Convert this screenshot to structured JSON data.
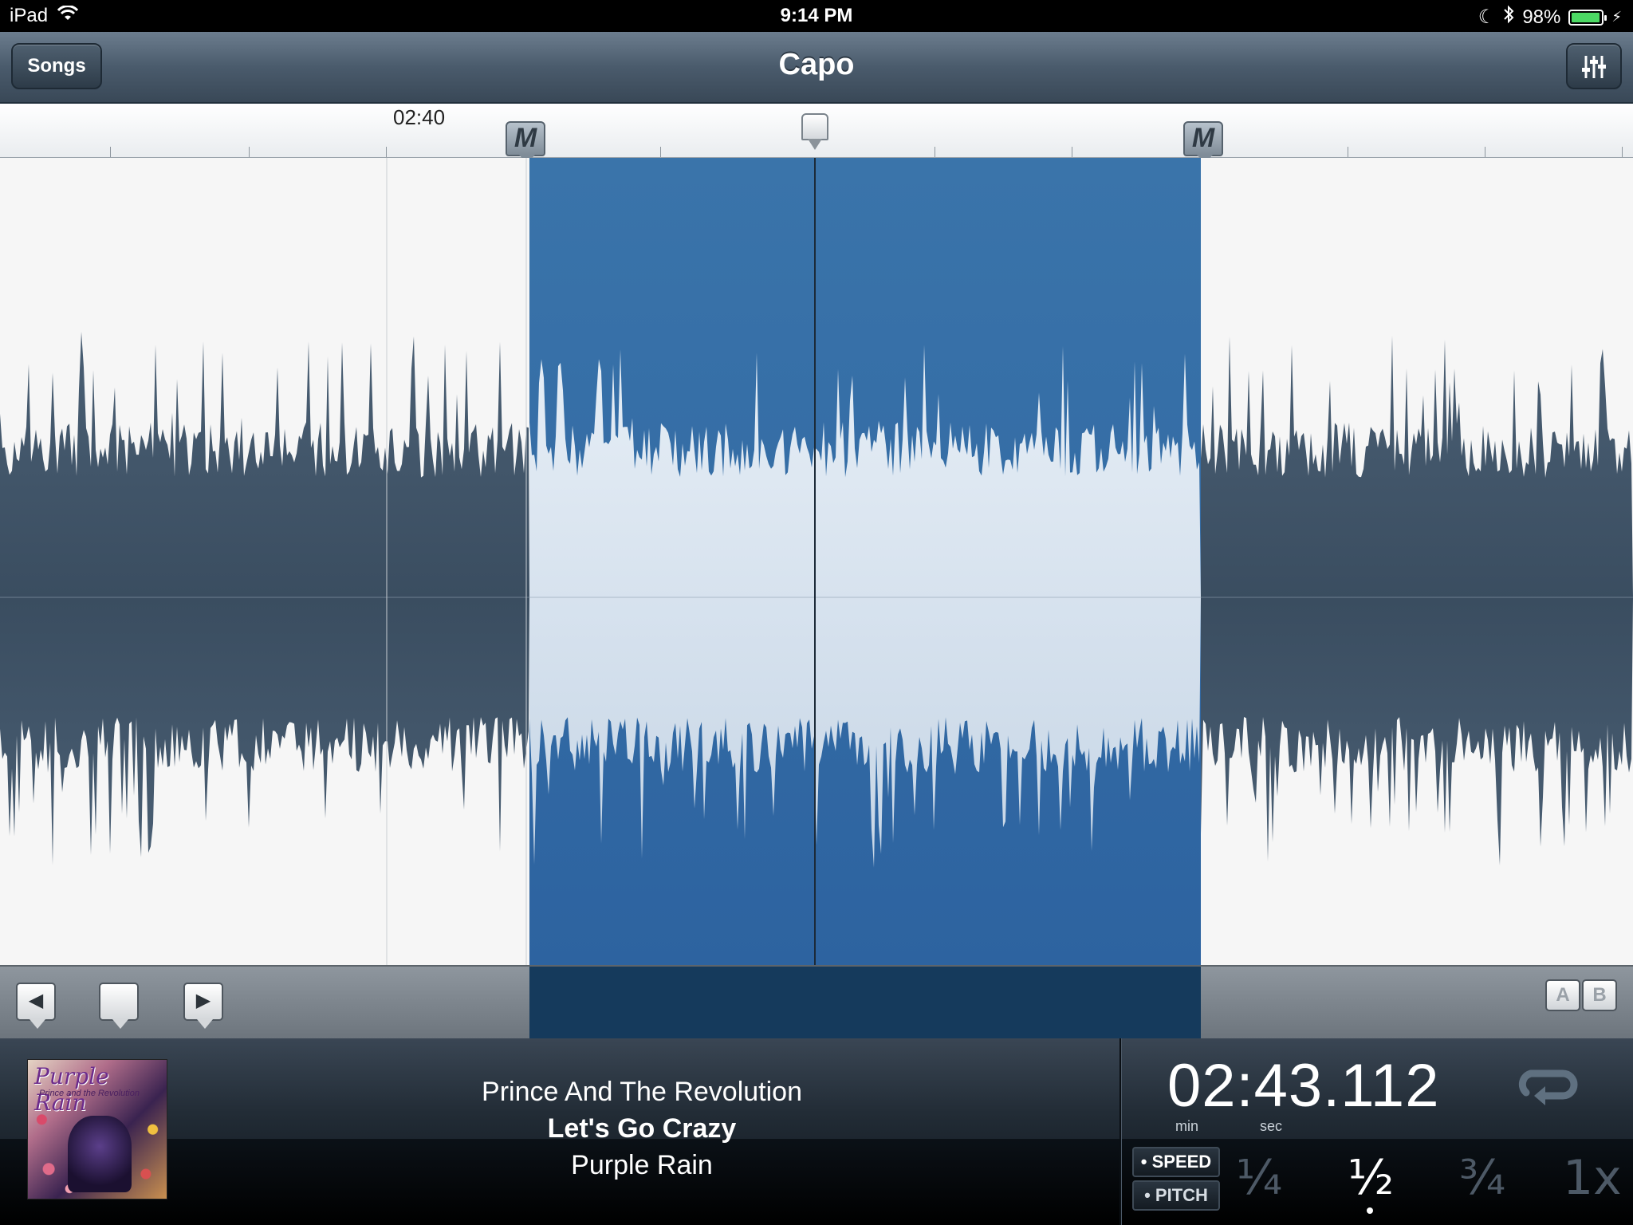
{
  "status_bar": {
    "device": "iPad",
    "time": "9:14 PM",
    "battery": "98%",
    "battery_level": 0.98
  },
  "nav": {
    "back_label": "Songs",
    "title": "Capo",
    "mixer_icon": "sliders-icon"
  },
  "timeline": {
    "time_label": "02:40",
    "marker_start_label": "M",
    "marker_end_label": "M"
  },
  "waveform_toolbar": {
    "prev_icon": "triangle-left-icon",
    "marker_icon": "bookmark-icon",
    "next_icon": "triangle-right-icon",
    "ab_a": "A",
    "ab_b": "B"
  },
  "track": {
    "artist": "Prince And The Revolution",
    "song": "Let's Go Crazy",
    "album": "Purple Rain",
    "album_art_title": "Purple Rain",
    "album_art_subtitle": "Prince and the Revolution"
  },
  "playback": {
    "time": "02:43.112",
    "unit_min": "min",
    "unit_sec": "sec",
    "loop_icon": "loop-icon",
    "speed_label": "SPEED",
    "pitch_label": "PITCH",
    "speed_options": [
      "¼",
      "½",
      "¾",
      "1x"
    ],
    "selected_speed": "½"
  },
  "colors": {
    "selection": "#3a73a9",
    "waveform": "#44596e",
    "selected_waveform_fill": "#d9e5f0"
  }
}
